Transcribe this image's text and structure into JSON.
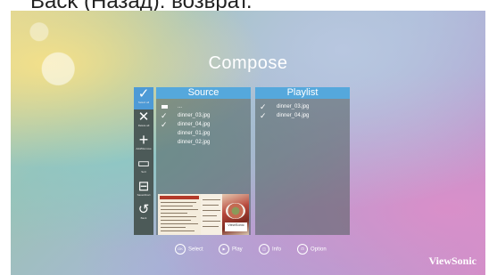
{
  "caption": {
    "bullet": "•",
    "text": "Back (Назад): возврат."
  },
  "screen": {
    "title": "Compose",
    "toolbar": [
      {
        "glyph": "✓",
        "label": "Select all"
      },
      {
        "glyph": "✕",
        "label": "Delete all"
      },
      {
        "glyph": "+",
        "label": "Add/Remove"
      },
      {
        "glyph": "▭",
        "label": "Sort"
      },
      {
        "glyph": "⊟",
        "label": "Save/Abort"
      },
      {
        "glyph": "↺",
        "label": "Back"
      }
    ],
    "source": {
      "header": "Source",
      "items": [
        {
          "check": "",
          "name": "..."
        },
        {
          "check": "✓",
          "name": "dinner_03.jpg"
        },
        {
          "check": "✓",
          "name": "dinner_04.jpg"
        },
        {
          "check": "",
          "name": "dinner_01.jpg"
        },
        {
          "check": "",
          "name": "dinner_02.jpg"
        }
      ],
      "preview_badge": "ViewSonic"
    },
    "playlist": {
      "header": "Playlist",
      "items": [
        {
          "check": "✓",
          "name": "dinner_03.jpg"
        },
        {
          "check": "✓",
          "name": "dinner_04.jpg"
        }
      ]
    },
    "controls": [
      {
        "icon": "OK",
        "label": "Select"
      },
      {
        "icon": "▶",
        "label": "Play"
      },
      {
        "icon": "◫",
        "label": "Info"
      },
      {
        "icon": "⊡",
        "label": "Option"
      }
    ],
    "brand": "ViewSonic",
    "colors": {
      "accent": "#55a8dc",
      "toolbar": "#4c5a58"
    }
  }
}
